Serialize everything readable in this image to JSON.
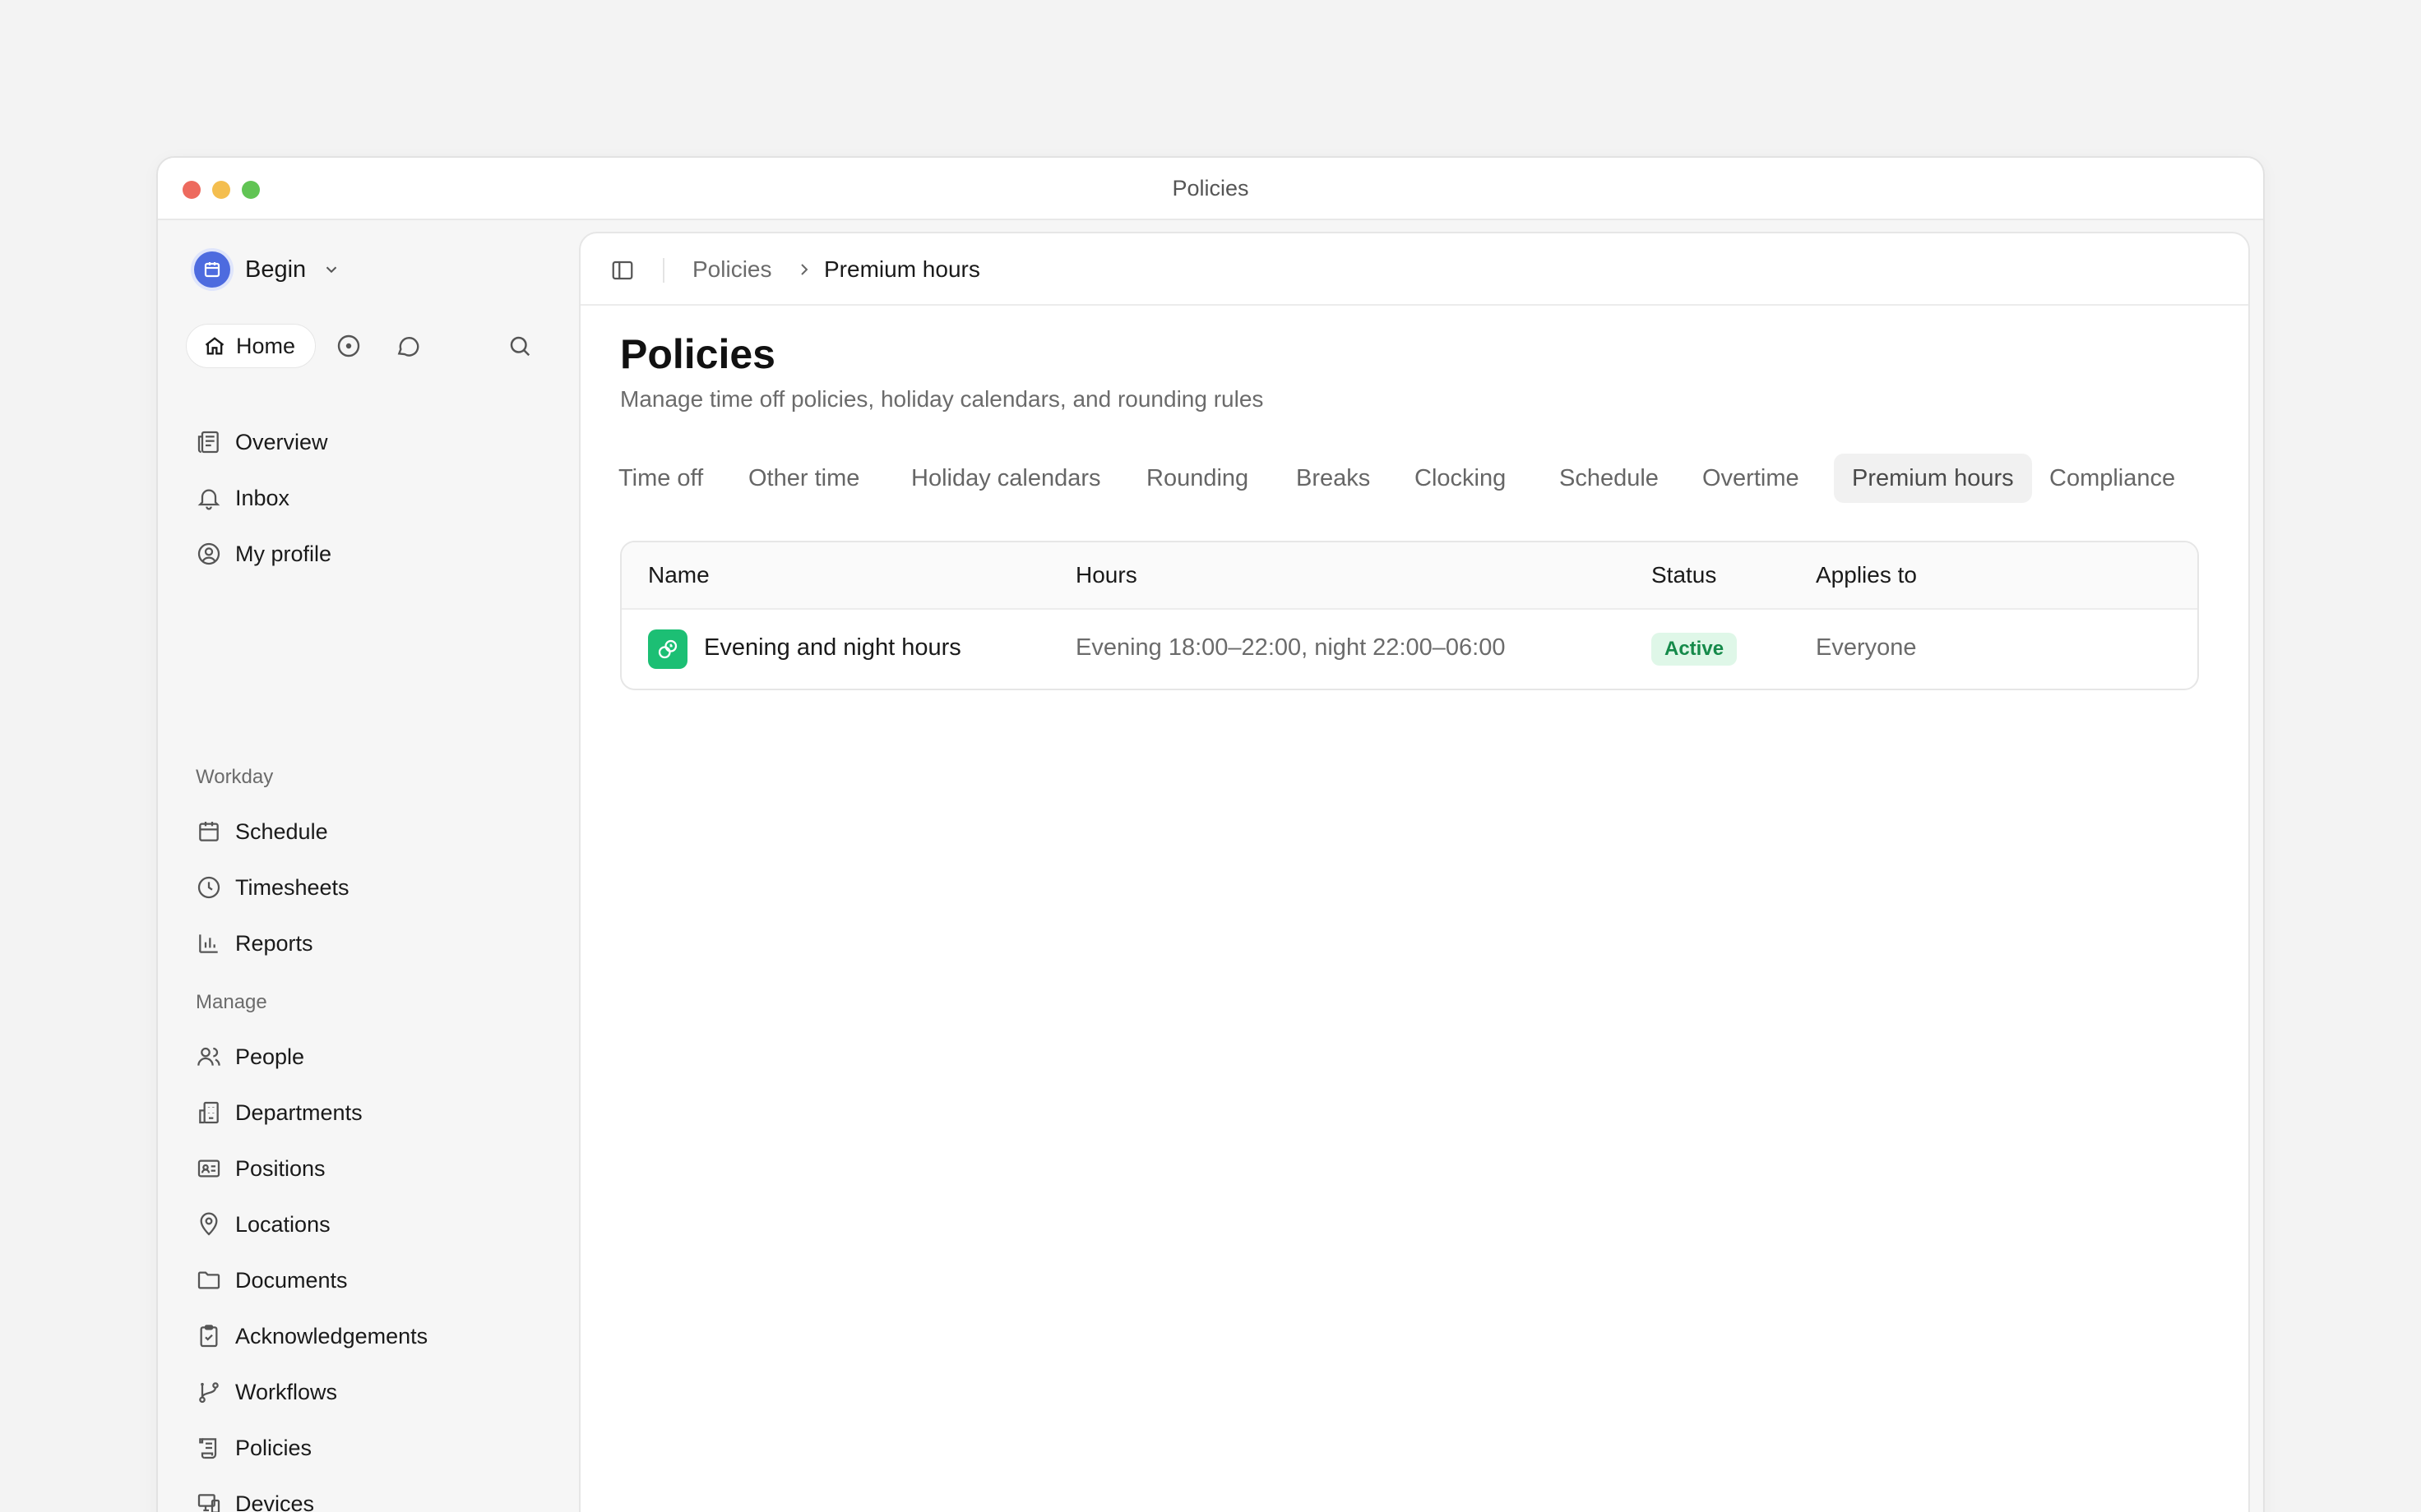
{
  "window": {
    "title": "Policies"
  },
  "workspace": {
    "name": "Begin"
  },
  "topnav": {
    "home_label": "Home"
  },
  "sidebar": {
    "primary": [
      {
        "label": "Overview",
        "icon": "newspaper-icon"
      },
      {
        "label": "Inbox",
        "icon": "bell-icon"
      },
      {
        "label": "My profile",
        "icon": "user-circle-icon"
      }
    ],
    "workday_heading": "Workday",
    "workday": [
      {
        "label": "Schedule",
        "icon": "calendar-icon"
      },
      {
        "label": "Timesheets",
        "icon": "clock-icon"
      },
      {
        "label": "Reports",
        "icon": "bar-chart-icon"
      }
    ],
    "manage_heading": "Manage",
    "manage": [
      {
        "label": "People",
        "icon": "users-icon"
      },
      {
        "label": "Departments",
        "icon": "building-icon"
      },
      {
        "label": "Positions",
        "icon": "id-card-icon"
      },
      {
        "label": "Locations",
        "icon": "map-pin-icon"
      },
      {
        "label": "Documents",
        "icon": "folder-icon"
      },
      {
        "label": "Acknowledgements",
        "icon": "clipboard-check-icon"
      },
      {
        "label": "Workflows",
        "icon": "git-branch-icon"
      },
      {
        "label": "Policies",
        "icon": "scroll-icon"
      },
      {
        "label": "Devices",
        "icon": "devices-icon"
      }
    ]
  },
  "breadcrumb": {
    "parent": "Policies",
    "current": "Premium hours"
  },
  "page": {
    "title": "Policies",
    "subtitle": "Manage time off policies, holiday calendars, and rounding rules"
  },
  "tabs": [
    {
      "label": "Time off"
    },
    {
      "label": "Other time"
    },
    {
      "label": "Holiday calendars"
    },
    {
      "label": "Rounding"
    },
    {
      "label": "Breaks"
    },
    {
      "label": "Clocking"
    },
    {
      "label": "Schedule"
    },
    {
      "label": "Overtime"
    },
    {
      "label": "Premium hours",
      "active": true
    },
    {
      "label": "Compliance"
    }
  ],
  "table": {
    "headers": {
      "name": "Name",
      "hours": "Hours",
      "status": "Status",
      "applies_to": "Applies to"
    },
    "rows": [
      {
        "name": "Evening and night hours",
        "hours": "Evening 18:00–22:00, night 22:00–06:00",
        "status": "Active",
        "applies_to": "Everyone"
      }
    ]
  },
  "colors": {
    "accent": "#4d6bdf",
    "row_icon": "#1cbf74",
    "status_active_bg": "#dff7e8",
    "status_active_fg": "#158a4a"
  }
}
